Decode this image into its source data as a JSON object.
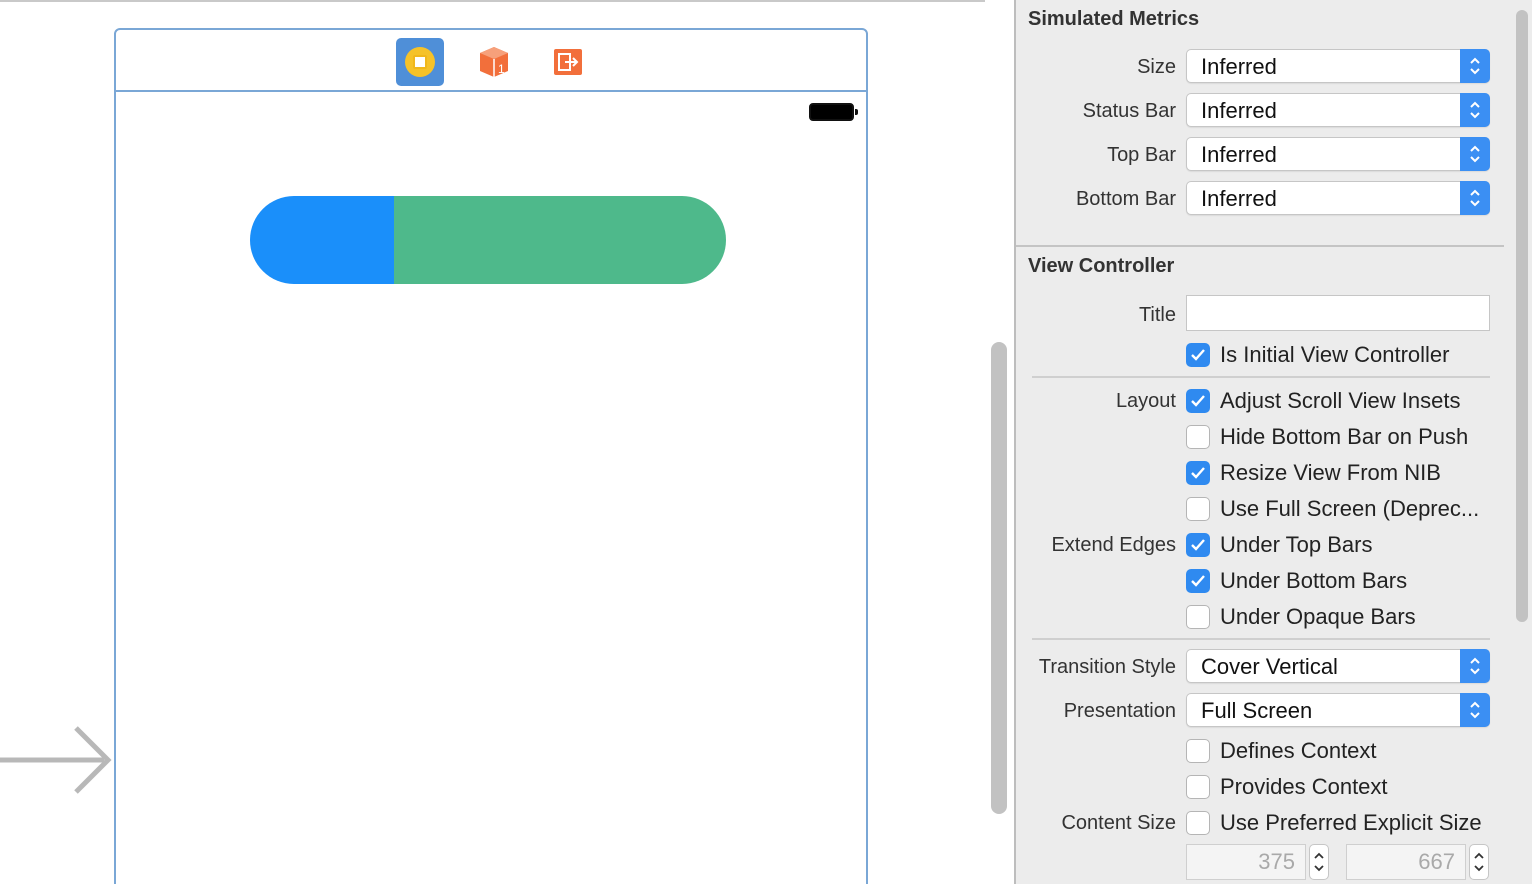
{
  "canvas": {
    "scene_icons": [
      "view-controller-icon",
      "first-responder-icon",
      "exit-icon"
    ],
    "segmented_colors": {
      "left": "#1a8ffa",
      "right": "#4eb98b"
    }
  },
  "inspector": {
    "simulated_metrics": {
      "title": "Simulated Metrics",
      "rows": [
        {
          "label": "Size",
          "value": "Inferred"
        },
        {
          "label": "Status Bar",
          "value": "Inferred"
        },
        {
          "label": "Top Bar",
          "value": "Inferred"
        },
        {
          "label": "Bottom Bar",
          "value": "Inferred"
        }
      ]
    },
    "view_controller": {
      "title": "View Controller",
      "title_label": "Title",
      "title_value": "",
      "initial": {
        "label": "Is Initial View Controller",
        "checked": true
      },
      "layout_label": "Layout",
      "layout": [
        {
          "label": "Adjust Scroll View Insets",
          "checked": true
        },
        {
          "label": "Hide Bottom Bar on Push",
          "checked": false
        },
        {
          "label": "Resize View From NIB",
          "checked": true
        },
        {
          "label": "Use Full Screen (Deprec...",
          "checked": false
        }
      ],
      "extend_edges_label": "Extend Edges",
      "extend_edges": [
        {
          "label": "Under Top Bars",
          "checked": true
        },
        {
          "label": "Under Bottom Bars",
          "checked": true
        },
        {
          "label": "Under Opaque Bars",
          "checked": false
        }
      ],
      "transition_style": {
        "label": "Transition Style",
        "value": "Cover Vertical"
      },
      "presentation": {
        "label": "Presentation",
        "value": "Full Screen"
      },
      "context": [
        {
          "label": "Defines Context",
          "checked": false
        },
        {
          "label": "Provides Context",
          "checked": false
        }
      ],
      "content_size_label": "Content Size",
      "content_size": {
        "label": "Use Preferred Explicit Size",
        "checked": false,
        "width": "375",
        "height": "667"
      }
    }
  },
  "colors": {
    "accent": "#2f8af0",
    "scene_border": "#7aa7d6"
  }
}
